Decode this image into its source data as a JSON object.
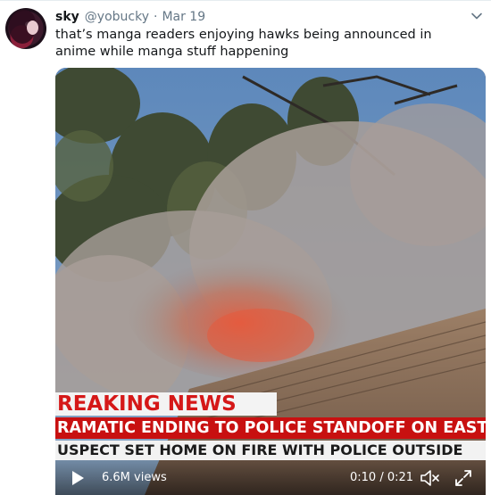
{
  "tweet": {
    "author_name": "sky",
    "author_handle": "@yobucky",
    "separator": "·",
    "date": "Mar 19",
    "text": "that’s manga readers enjoying hawks being announced in anime while manga stuff happening"
  },
  "video": {
    "banner_breaking": "REAKING NEWS",
    "banner_headline": "RAMATIC ENDING TO POLICE STANDOFF ON EAST SIDE",
    "banner_subline": "USPECT SET HOME ON FIRE WITH POLICE OUTSIDE",
    "views": "6.6M views",
    "time": "0:10 / 0:21"
  },
  "icons": {
    "chevron": "chevron-down-icon",
    "play": "play-icon",
    "mute": "volume-muted-icon",
    "fullscreen": "fullscreen-icon"
  },
  "colors": {
    "handle": "#657786",
    "banner_red": "#c81010",
    "breaking_red": "#d51818"
  }
}
